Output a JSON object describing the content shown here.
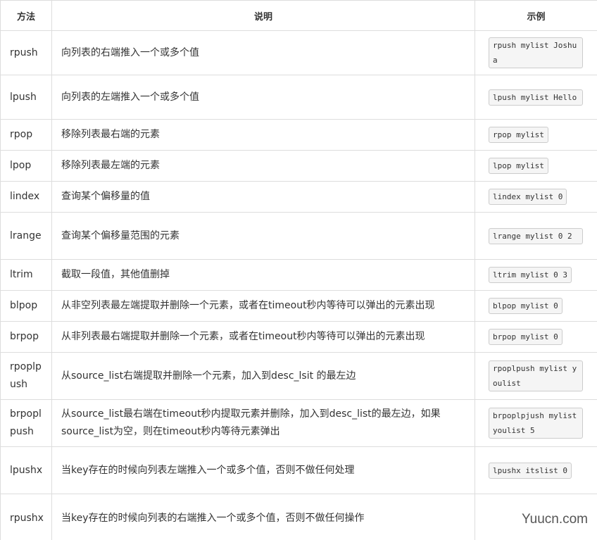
{
  "headers": {
    "method": "方法",
    "description": "说明",
    "example": "示例"
  },
  "rows": [
    {
      "method": "rpush",
      "desc": "向列表的右端推入一个或多个值",
      "example": "rpush mylist Joshua"
    },
    {
      "method": "lpush",
      "desc": "向列表的左端推入一个或多个值",
      "example": "lpush mylist Hello"
    },
    {
      "method": "rpop",
      "desc": "移除列表最右端的元素",
      "example": "rpop mylist"
    },
    {
      "method": "lpop",
      "desc": "移除列表最左端的元素",
      "example": "lpop mylist"
    },
    {
      "method": "lindex",
      "desc": "查询某个偏移量的值",
      "example": "lindex mylist 0"
    },
    {
      "method": "lrange",
      "desc": "查询某个偏移量范围的元素",
      "example": "lrange mylist 0 2"
    },
    {
      "method": "ltrim",
      "desc": "截取一段值，其他值删掉",
      "example": "ltrim mylist 0 3"
    },
    {
      "method": "blpop",
      "desc": "从非空列表最左端提取并删除一个元素，或者在timeout秒内等待可以弹出的元素出现",
      "example": "blpop mylist 0"
    },
    {
      "method": "brpop",
      "desc": "从非列表最右端提取并删除一个元素，或者在timeout秒内等待可以弹出的元素出现",
      "example": "brpop mylist 0"
    },
    {
      "method": "rpoplpush",
      "desc": "从source_list右端提取并删除一个元素，加入到desc_lsit 的最左边",
      "example": "rpoplpush mylist youlist"
    },
    {
      "method": "brpoplpush",
      "desc": "从source_list最右端在timeout秒内提取元素并删除，加入到desc_list的最左边，如果source_list为空，则在timeout秒内等待元素弹出",
      "example": "brpoplpjush mylist youlist 5"
    },
    {
      "method": "lpushx",
      "desc": "当key存在的时候向列表左端推入一个或多个值，否则不做任何处理",
      "example": "lpushx itslist 0"
    },
    {
      "method": "rpushx",
      "desc": "当key存在的时候向列表的右端推入一个或多个值，否则不做任何操作",
      "example": ""
    }
  ],
  "watermark": "Yuucn.com"
}
